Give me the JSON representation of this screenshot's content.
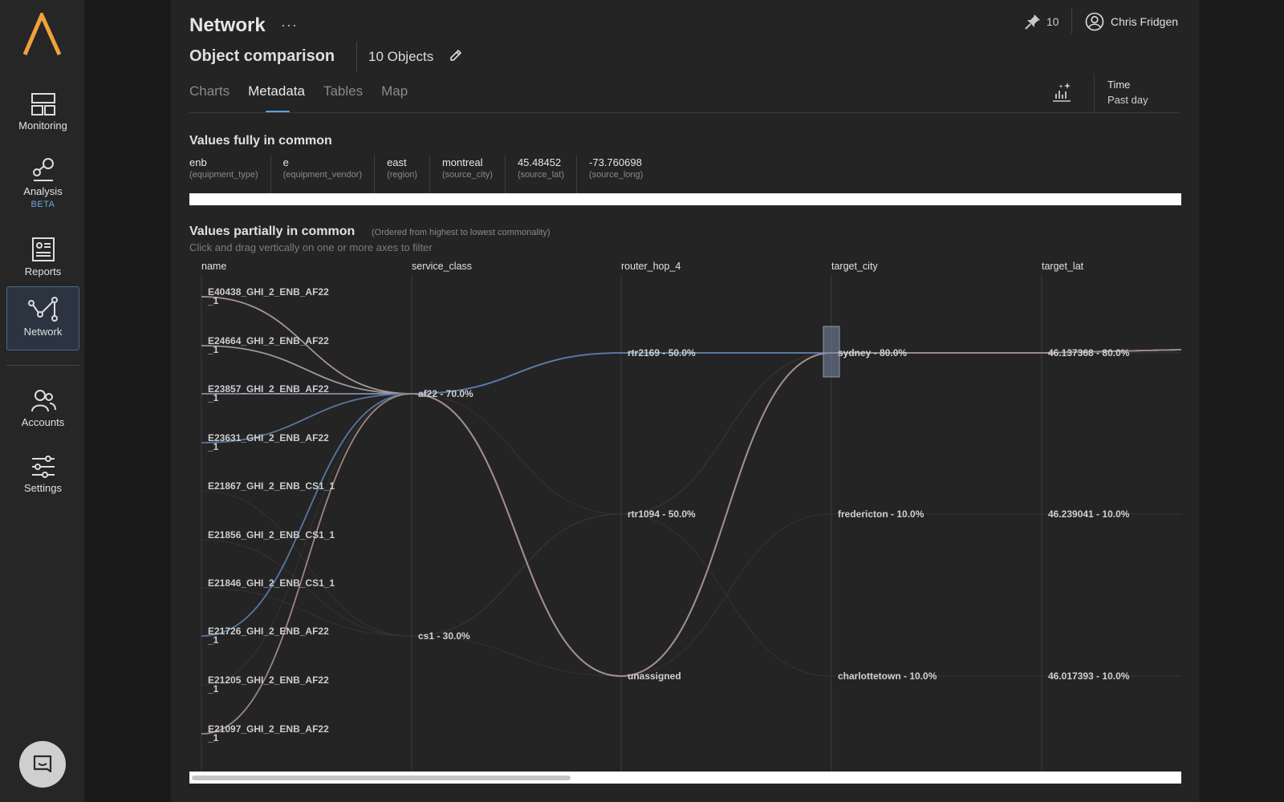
{
  "sidebar": {
    "items": [
      {
        "id": "monitoring",
        "label": "Monitoring",
        "icon": "dashboard-icon"
      },
      {
        "id": "analysis",
        "label": "Analysis",
        "badge": "BETA",
        "icon": "analysis-icon"
      },
      {
        "id": "reports",
        "label": "Reports",
        "icon": "report-icon"
      },
      {
        "id": "network",
        "label": "Network",
        "icon": "network-icon",
        "active": true
      },
      {
        "id": "accounts",
        "label": "Accounts",
        "icon": "users-icon"
      },
      {
        "id": "settings",
        "label": "Settings",
        "icon": "sliders-icon"
      }
    ]
  },
  "header": {
    "title": "Network",
    "more": "···",
    "subtitle": "Object comparison",
    "object_count": "10 Objects",
    "pin_count": "10",
    "user_name": "Chris Fridgen"
  },
  "tabs": [
    {
      "label": "Charts",
      "active": false
    },
    {
      "label": "Metadata",
      "active": true
    },
    {
      "label": "Tables",
      "active": false
    },
    {
      "label": "Map",
      "active": false
    }
  ],
  "time": {
    "label": "Time",
    "value": "Past day"
  },
  "full_common": {
    "title": "Values fully in common",
    "items": [
      {
        "value": "enb",
        "key": "(equipment_type)"
      },
      {
        "value": "e",
        "key": "(equipment_vendor)"
      },
      {
        "value": "east",
        "key": "(region)"
      },
      {
        "value": "montreal",
        "key": "(source_city)"
      },
      {
        "value": "45.48452",
        "key": "(source_lat)"
      },
      {
        "value": "-73.760698",
        "key": "(source_long)"
      }
    ]
  },
  "partial_common": {
    "title": "Values partially in common",
    "note": "(Ordered from highest to lowest commonality)",
    "hint": "Click and drag vertically on one or more axes to filter"
  },
  "chart_data": {
    "type": "parallel-coordinates",
    "axes": [
      "name",
      "service_class",
      "router_hop_4",
      "target_city",
      "target_lat"
    ],
    "axis_values": {
      "name": [
        [
          "E40438_GHI_2_ENB_AF22",
          "_1"
        ],
        [
          "E24664_GHI_2_ENB_AF22",
          "_1"
        ],
        [
          "E23857_GHI_2_ENB_AF22",
          "_1"
        ],
        [
          "E23631_GHI_2_ENB_AF22",
          "_1"
        ],
        [
          "E21867_GHI_2_ENB_CS1_1"
        ],
        [
          "E21856_GHI_2_ENB_CS1_1"
        ],
        [
          "E21846_GHI_2_ENB_CS1_1"
        ],
        [
          "E21726_GHI_2_ENB_AF22",
          "_1"
        ],
        [
          "E21205_GHI_2_ENB_AF22",
          "_1"
        ],
        [
          "E21097_GHI_2_ENB_AF22",
          "_1"
        ]
      ],
      "service_class": [
        "af22 - 70.0%",
        "cs1 - 30.0%"
      ],
      "router_hop_4": [
        "rtr2169 - 50.0%",
        "rtr1094 - 50.0%",
        "unassigned"
      ],
      "target_city": [
        "sydney - 80.0%",
        "fredericton - 10.0%",
        "charlottetown - 10.0%"
      ],
      "target_lat": [
        "46.137368 - 80.0%",
        "46.239041 - 10.0%",
        "46.017393 - 10.0%"
      ]
    },
    "lines": [
      {
        "name": "E40438_GHI_2_ENB_AF22_1",
        "values": [
          "E40438_GHI_2_ENB_AF22_1",
          "af22 - 70.0%",
          "unassigned",
          "sydney - 80.0%",
          "46.137368 - 80.0%"
        ],
        "color": "#b39a9a",
        "highlight": true
      },
      {
        "name": "E24664_GHI_2_ENB_AF22_1",
        "values": [
          "E24664_GHI_2_ENB_AF22_1",
          "af22 - 70.0%",
          "unassigned",
          "sydney - 80.0%",
          "46.137368 - 80.0%"
        ],
        "color": "#9f9ea8",
        "highlight": true
      },
      {
        "name": "E23857_GHI_2_ENB_AF22_1",
        "values": [
          "E23857_GHI_2_ENB_AF22_1",
          "af22 - 70.0%",
          "unassigned",
          "sydney - 80.0%",
          "46.137368 - 80.0%"
        ],
        "color": "#8a96aa",
        "highlight": true
      },
      {
        "name": "E23631_GHI_2_ENB_AF22_1",
        "values": [
          "E23631_GHI_2_ENB_AF22_1",
          "af22 - 70.0%",
          "rtr2169 - 50.0%",
          "sydney - 80.0%",
          "46.137368 - 80.0%"
        ],
        "color": "#5d7aa4",
        "highlight": true
      },
      {
        "name": "E21867_GHI_2_ENB_CS1_1",
        "values": [
          "E21867_GHI_2_ENB_CS1_1",
          "cs1 - 30.0%",
          "rtr1094 - 50.0%",
          "charlottetown - 10.0%",
          "46.017393 - 10.0%"
        ],
        "color": "#3a3a3a",
        "highlight": false
      },
      {
        "name": "E21856_GHI_2_ENB_CS1_1",
        "values": [
          "E21856_GHI_2_ENB_CS1_1",
          "cs1 - 30.0%",
          "unassigned",
          "fredericton - 10.0%",
          "46.239041 - 10.0%"
        ],
        "color": "#3a3a3a",
        "highlight": false
      },
      {
        "name": "E21846_GHI_2_ENB_CS1_1",
        "values": [
          "E21846_GHI_2_ENB_CS1_1",
          "cs1 - 30.0%",
          "rtr1094 - 50.0%",
          "sydney - 80.0%",
          "46.137368 - 80.0%"
        ],
        "color": "#3a3a3a",
        "highlight": false
      },
      {
        "name": "E21726_GHI_2_ENB_AF22_1",
        "values": [
          "E21726_GHI_2_ENB_AF22_1",
          "af22 - 70.0%",
          "rtr2169 - 50.0%",
          "sydney - 80.0%",
          "46.137368 - 80.0%"
        ],
        "color": "#5a7ba8",
        "highlight": true
      },
      {
        "name": "E21205_GHI_2_ENB_AF22_1",
        "values": [
          "E21205_GHI_2_ENB_AF22_1",
          "af22 - 70.0%",
          "rtr1094 - 50.0%",
          "sydney - 80.0%",
          "46.137368 - 80.0%"
        ],
        "color": "#3a3a3a",
        "highlight": false
      },
      {
        "name": "E21097_GHI_2_ENB_AF22_1",
        "values": [
          "E21097_GHI_2_ENB_AF22_1",
          "af22 - 70.0%",
          "unassigned",
          "sydney - 80.0%",
          "46.137368 - 80.0%"
        ],
        "color": "#a88a8a",
        "highlight": true
      }
    ],
    "brush": {
      "axis": "target_city",
      "value": "sydney - 80.0%"
    },
    "colors": {
      "axis": "#3c3c3c",
      "background": "#242424",
      "brush": "#7888a4"
    }
  }
}
